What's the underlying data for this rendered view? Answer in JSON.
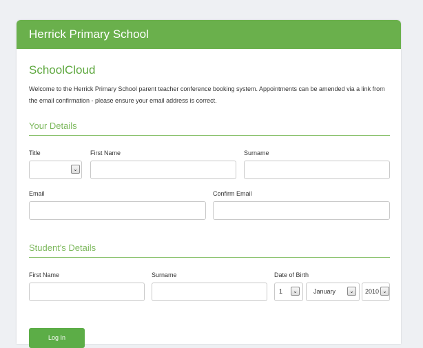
{
  "header": {
    "school_name": "Herrick Primary School"
  },
  "app_name": "SchoolCloud",
  "intro_text": "Welcome to the Herrick Primary School parent teacher conference booking system. Appointments can be amended via a link from the email confirmation - please ensure your email address is correct.",
  "your_details": {
    "title": "Your Details",
    "title_label": "Title",
    "title_value": "",
    "first_name_label": "First Name",
    "surname_label": "Surname",
    "email_label": "Email",
    "confirm_email_label": "Confirm Email"
  },
  "student_details": {
    "title": "Student's Details",
    "first_name_label": "First Name",
    "surname_label": "Surname",
    "dob_label": "Date of Birth",
    "dob_day": "1",
    "dob_month": "January",
    "dob_year": "2010"
  },
  "login_button": "Log In",
  "icons": {
    "dropdown": "chevron-down-icon"
  },
  "colors": {
    "brand_green": "#6ab04c",
    "accent_text": "#7cb85c"
  }
}
